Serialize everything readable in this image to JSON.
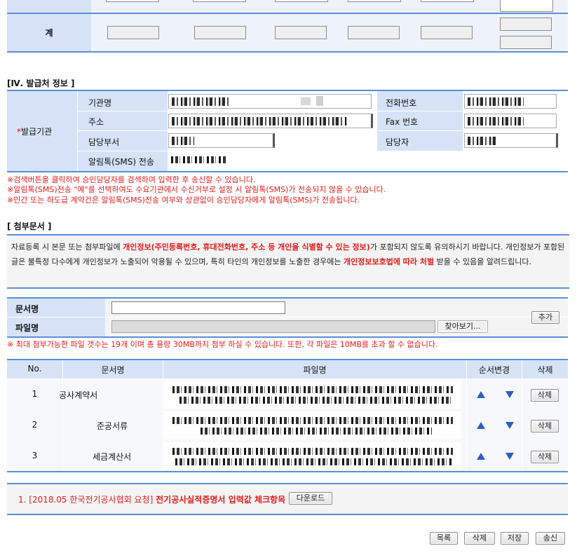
{
  "total_row": {
    "label": "계"
  },
  "issuer": {
    "section_title": "[Ⅳ. 발급처 정보 ]",
    "group_label": "발급기관",
    "required_mark": "*",
    "fields": {
      "agency_name": "기관명",
      "phone": "전화번호",
      "address": "주소",
      "fax": "Fax 번호",
      "department": "담당부서",
      "manager": "담당자",
      "sms": "알림톡(SMS) 전송"
    },
    "notes": [
      "※검색버튼을 클릭하여 승인담당자를 검색하여 입력한 후 송신할 수 있습니다.",
      "※알림톡(SMS)전송 \"예\"를 선택하여도 수요기관에서 수신거부로 설정 시 알림톡(SMS)가 전송되지 않을 수 있습니다.",
      "※민간 또는 하도급 계약건은 알림톡(SMS)전송 여부와 상관없이 승인담당자에게 알림톡(SMS)가 전송됩니다."
    ]
  },
  "attachments": {
    "section_title": "[ 첨부문서 ]",
    "privacy_notice": {
      "part1": "자료등록 시 본문 또는 첨부파일에 ",
      "part2_red": "개인정보(주민등록번호, 휴대전화번호, 주소 등 개인을 식별할 수 있는 정보)",
      "part3": "가 포함되지 않도록 유의하시기 바랍니다. 개인정보가 포함된 글은 불특정 다수에게 개인정보가 노출되어 악용될 수 있으며, 특히 타인의 개인정보를 노출한 경우에는 ",
      "part4_red": "개인정보보호법에 따라 처벌",
      "part5": " 받을 수 있음을 알려드립니다."
    },
    "doc_name_label": "문서명",
    "file_name_label": "파일명",
    "browse_button": "찾아보기...",
    "add_button": "추가",
    "limit_note": "※ 최대 첨부가능한 파일 갯수는 19개 이며 총 용량 30MB까지 첨부 하실 수 있습니다. 또한, 각 파일은 10MB를 초과 할 수 없습니다.",
    "table": {
      "headers": [
        "No.",
        "문서명",
        "파일명",
        "순서변경",
        "삭제"
      ],
      "rows": [
        {
          "no": "1",
          "doc": "공사계약서",
          "delete": "삭제"
        },
        {
          "no": "2",
          "doc": "준공서류",
          "delete": "삭제"
        },
        {
          "no": "3",
          "doc": "세금계산서",
          "delete": "삭제"
        }
      ]
    }
  },
  "checklist": {
    "item_prefix": "1. [2018.05 한국전기공사협회 요청] ",
    "item_bold": "전기공사실적증명서 입력값 체크항목",
    "download_button": "다운로드"
  },
  "footer_buttons": {
    "list": "목록",
    "delete": "삭제",
    "save": "저장",
    "send": "송신"
  },
  "colors": {
    "header_blue": "#d6e3f6",
    "border_blue": "#5b8fd6",
    "notice_red": "#e21c1c",
    "arrow_blue": "#2b5fc2"
  }
}
